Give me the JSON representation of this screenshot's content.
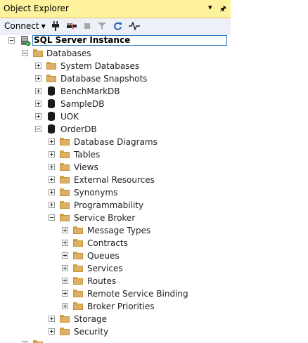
{
  "window": {
    "title": "Object Explorer"
  },
  "toolbar": {
    "connect_label": "Connect",
    "icons": [
      "dropdown-arrow-icon",
      "plug-icon",
      "unplug-icon",
      "stop-icon",
      "filter-icon",
      "refresh-icon",
      "activity-monitor-icon"
    ]
  },
  "tree": {
    "server": "SQL Server Instance",
    "databases": "Databases",
    "system_databases": "System Databases",
    "database_snapshots": "Database Snapshots",
    "benchmarkdb": "BenchMarkDB",
    "sampledb": "SampleDB",
    "uok": "UOK",
    "orderdb": "OrderDB",
    "database_diagrams": "Database Diagrams",
    "tables": "Tables",
    "views": "Views",
    "external_resources": "External Resources",
    "synonyms": "Synonyms",
    "programmability": "Programmability",
    "service_broker": "Service Broker",
    "message_types": "Message Types",
    "contracts": "Contracts",
    "queues": "Queues",
    "services": "Services",
    "routes": "Routes",
    "remote_service_binding": "Remote Service Binding",
    "broker_priorities": "Broker Priorities",
    "storage": "Storage",
    "security": "Security"
  },
  "colors": {
    "title_bar": "#fff29d",
    "toolbar": "#eef0f8",
    "folder": "#dcb067",
    "selection_border": "#2d79c7"
  }
}
